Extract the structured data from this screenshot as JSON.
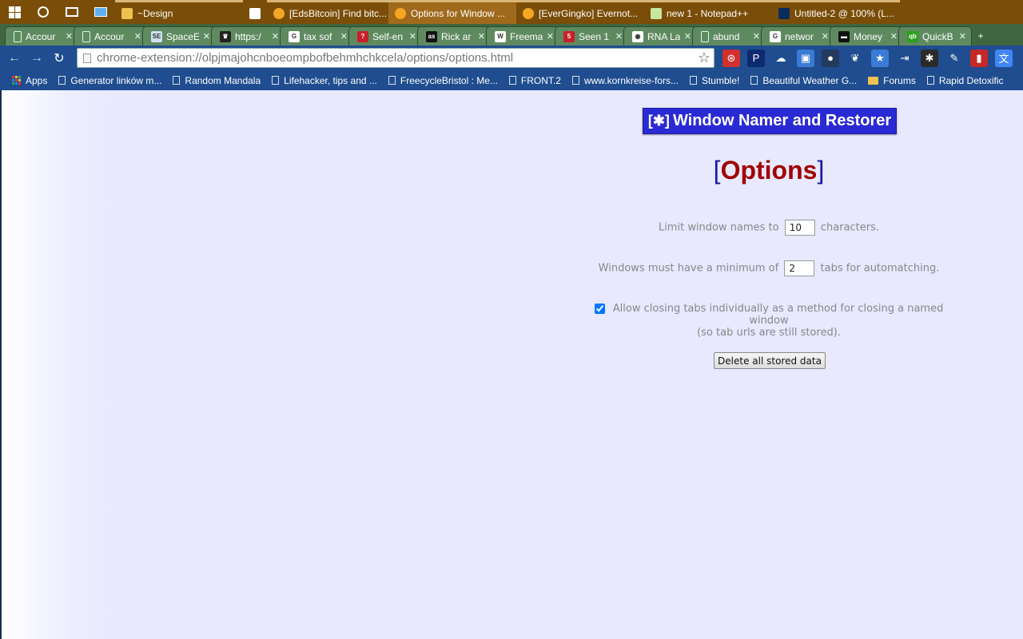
{
  "taskbar": {
    "apps": [
      {
        "label": "~Design",
        "icon": "folder-icon",
        "color": "#f0c052",
        "state": "open"
      },
      {
        "label": "",
        "icon": "store-icon",
        "color": "#ffffff",
        "state": "none"
      },
      {
        "label": "[EdsBitcoin] Find bitc...",
        "icon": "chrome-icon",
        "color": "#f5a623",
        "state": "open"
      },
      {
        "label": "Options for Window ...",
        "icon": "chrome-icon",
        "color": "#f5a623",
        "state": "active"
      },
      {
        "label": "[EverGingko] Evernot...",
        "icon": "chrome-icon",
        "color": "#f5a623",
        "state": "open"
      },
      {
        "label": "new 1 - Notepad++",
        "icon": "notepad-icon",
        "color": "#c9e6a0",
        "state": "open"
      },
      {
        "label": "Untitled-2 @ 100% (L...",
        "icon": "photoshop-icon",
        "color": "#0a2c5a",
        "state": "open"
      }
    ]
  },
  "tabs": [
    {
      "label": "Accour",
      "favicon": "document-icon",
      "color": "#5f8a60",
      "glyph": ""
    },
    {
      "label": "Accour",
      "favicon": "document-icon",
      "color": "#5f8a60",
      "glyph": ""
    },
    {
      "label": "SpaceE",
      "favicon": "stackexchange-icon",
      "color": "#cfe0ee",
      "glyph": "SE"
    },
    {
      "label": "https:/",
      "favicon": "crown-icon",
      "color": "#222222",
      "glyph": "♛"
    },
    {
      "label": "tax sof",
      "favicon": "google-icon",
      "color": "#ffffff",
      "glyph": "G"
    },
    {
      "label": "Self-en",
      "favicon": "question-icon",
      "color": "#c8202a",
      "glyph": "?"
    },
    {
      "label": "Rick ar",
      "favicon": "as-icon",
      "color": "#111111",
      "glyph": "as"
    },
    {
      "label": "Freema",
      "favicon": "wikipedia-icon",
      "color": "#ffffff",
      "glyph": "W"
    },
    {
      "label": "Seen 1",
      "favicon": "five-icon",
      "color": "#c8202a",
      "glyph": "5"
    },
    {
      "label": "RNA La",
      "favicon": "pbs-icon",
      "color": "#ffffff",
      "glyph": "◉"
    },
    {
      "label": "abund",
      "favicon": "document-icon",
      "color": "#5f8a60",
      "glyph": ""
    },
    {
      "label": "networ",
      "favicon": "google-icon",
      "color": "#ffffff",
      "glyph": "G"
    },
    {
      "label": "Money",
      "favicon": "money-icon",
      "color": "#111111",
      "glyph": "▬"
    },
    {
      "label": "QuickB",
      "favicon": "quickbooks-icon",
      "color": "#2ca01c",
      "glyph": "qb"
    }
  ],
  "toolbar": {
    "url": "chrome-extension://olpjmajohcnboeompbofbehmhchkcela/options/options.html"
  },
  "extensions": [
    {
      "name": "lastpass-icon",
      "glyph": "⊛",
      "color": "#d32f2f"
    },
    {
      "name": "pocket-p-icon",
      "glyph": "P",
      "color": "#0e2a6e"
    },
    {
      "name": "cloud-icon",
      "glyph": "☁",
      "color": "#1f4d8f"
    },
    {
      "name": "window-icon",
      "glyph": "▣",
      "color": "#3a7bd5"
    },
    {
      "name": "ghost-icon",
      "glyph": "●",
      "color": "#243a5e"
    },
    {
      "name": "evernote-icon",
      "glyph": "❦",
      "color": "#1f4d8f"
    },
    {
      "name": "star-badge-icon",
      "glyph": "★",
      "color": "#3a7bd5"
    },
    {
      "name": "arrow-in-icon",
      "glyph": "⇥",
      "color": "#1f4d8f"
    },
    {
      "name": "window-namer-icon",
      "glyph": "✱",
      "color": "#2b2b2b"
    },
    {
      "name": "notepad-edit-icon",
      "glyph": "✎",
      "color": "#1f4d8f"
    },
    {
      "name": "red-book-icon",
      "glyph": "▮",
      "color": "#c62828"
    },
    {
      "name": "translate-icon",
      "glyph": "文",
      "color": "#4285f4"
    }
  ],
  "bookmarks": {
    "apps_label": "Apps",
    "items": [
      {
        "label": "Generator linków m...",
        "type": "page"
      },
      {
        "label": "Random Mandala",
        "type": "page"
      },
      {
        "label": "Lifehacker, tips and ...",
        "type": "page"
      },
      {
        "label": "FreecycleBristol : Me...",
        "type": "page"
      },
      {
        "label": "FRONT.2",
        "type": "page"
      },
      {
        "label": "www.kornkreise-fors...",
        "type": "page"
      },
      {
        "label": "Stumble!",
        "type": "page"
      },
      {
        "label": "Beautiful Weather G...",
        "type": "page"
      },
      {
        "label": "Forums",
        "type": "folder"
      },
      {
        "label": "Rapid Detoxific",
        "type": "page"
      }
    ]
  },
  "page": {
    "banner_badge": "[✱]",
    "banner_title": "Window Namer and Restorer",
    "options_open": "[",
    "options_word": "Options",
    "options_close": "]",
    "limit_prefix": "Limit window names to",
    "limit_value": "10",
    "limit_suffix": "characters.",
    "min_prefix": "Windows must have a minimum of",
    "min_value": "2",
    "min_suffix": "tabs for automatching.",
    "closing_label_line1": "Allow closing tabs individually as a method for closing a named window",
    "closing_label_line2": "(so tab urls are still stored).",
    "closing_checked": true,
    "delete_label": "Delete all stored data"
  }
}
